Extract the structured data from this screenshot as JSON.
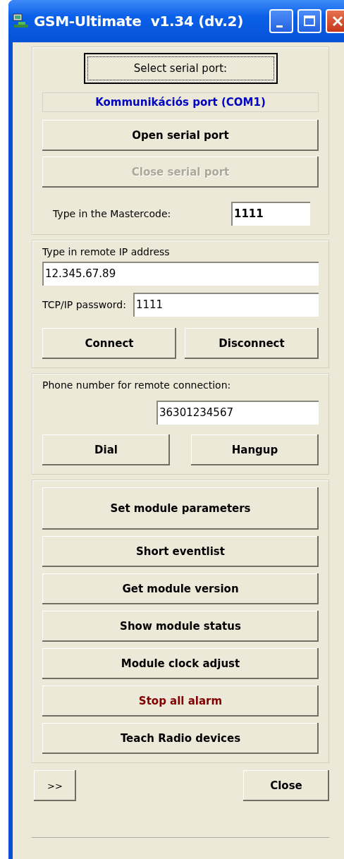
{
  "window": {
    "title": "GSM-Ultimate  v1.34 (dv.2)"
  },
  "serial": {
    "select_button": {
      "label": "Select serial port:",
      "focused": true
    },
    "port_label": "Kommunikációs port (COM1)",
    "buttons": [
      {
        "label": "Open serial port",
        "disabled": false
      },
      {
        "label": "Close serial port",
        "disabled": true
      }
    ],
    "mastercode": {
      "label": "Type in the Mastercode:",
      "value": "1111"
    }
  },
  "tcp": {
    "ip_label": "Type in remote IP address",
    "ip_value": "12.345.67.89",
    "password_label": "TCP/IP password:",
    "password_value": "1111",
    "buttons": [
      "Connect",
      "Disconnect"
    ]
  },
  "phone": {
    "label": "Phone number for remote connection:",
    "value": "36301234567",
    "buttons": [
      "Dial",
      "Hangup"
    ]
  },
  "module_buttons": [
    {
      "label": "Set module parameters",
      "kind": "large"
    },
    {
      "label": "Short eventlist",
      "kind": "normal"
    },
    {
      "label": "Get module version",
      "kind": "normal"
    },
    {
      "label": "Show module status",
      "kind": "normal"
    },
    {
      "label": "Module clock adjust",
      "kind": "normal"
    },
    {
      "label": "Stop all alarm",
      "kind": "alarm"
    },
    {
      "label": "Teach Radio devices",
      "kind": "normal"
    }
  ],
  "footer": {
    "buttons": [
      ">>",
      "Close"
    ]
  }
}
